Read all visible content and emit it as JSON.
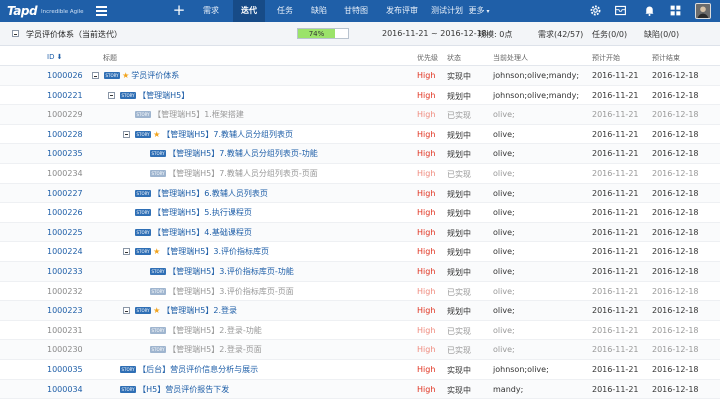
{
  "app": {
    "logo_main": "Tapd",
    "logo_sub": "Incredible Agile"
  },
  "nav": {
    "items": [
      {
        "label": "需求",
        "active": false
      },
      {
        "label": "迭代",
        "active": true
      },
      {
        "label": "任务",
        "active": false
      },
      {
        "label": "缺陷",
        "active": false
      },
      {
        "label": "甘特图",
        "active": false
      },
      {
        "label": "发布评审",
        "active": false
      },
      {
        "label": "测试计划",
        "active": false
      },
      {
        "label": "更多",
        "active": false
      }
    ],
    "icons": [
      "plus-icon",
      "menu-icon",
      "gear-icon",
      "inbox-icon",
      "bell-icon",
      "apps-grid-icon"
    ]
  },
  "summary": {
    "title": "学员评价体系（当前迭代）",
    "progress_label": "74%",
    "progress": 0.74,
    "dates": "2016-11-21 ~ 2016-12-18",
    "scale": "规模: 0点",
    "requirements": "需求(42/57)",
    "tasks": "任务(0/0)",
    "bugs": "缺陷(0/0)"
  },
  "columns": {
    "id": "ID ⬇",
    "title": "标题",
    "priority": "优先级",
    "status": "状态",
    "owner": "当前处理人",
    "start": "预计开始",
    "end": "预计结束"
  },
  "rows": [
    {
      "id": "1000026",
      "level": 0,
      "collapse": true,
      "star": true,
      "title": "学员评价体系",
      "priority": "High",
      "status": "实现中",
      "owner": "johnson;olive;mandy;",
      "start": "2016-11-21",
      "end": "2016-12-18",
      "done": false
    },
    {
      "id": "1000221",
      "level": 1,
      "collapse": true,
      "star": false,
      "title": "【管理端H5】",
      "priority": "High",
      "status": "规划中",
      "owner": "johnson;olive;mandy;",
      "start": "2016-11-21",
      "end": "2016-12-18",
      "done": false
    },
    {
      "id": "1000229",
      "level": 2,
      "collapse": false,
      "star": false,
      "title": "【管理端H5】1.框架搭建",
      "priority": "High",
      "status": "已实现",
      "owner": "olive;",
      "start": "2016-11-21",
      "end": "2016-12-18",
      "done": true
    },
    {
      "id": "1000228",
      "level": 2,
      "collapse": true,
      "star": true,
      "title": "【管理端H5】7.教辅人员分组列表页",
      "priority": "High",
      "status": "规划中",
      "owner": "olive;",
      "start": "2016-11-21",
      "end": "2016-12-18",
      "done": false
    },
    {
      "id": "1000235",
      "level": 3,
      "collapse": false,
      "star": false,
      "title": "【管理端H5】7.教辅人员分组列表页-功能",
      "priority": "High",
      "status": "规划中",
      "owner": "olive;",
      "start": "2016-11-21",
      "end": "2016-12-18",
      "done": false
    },
    {
      "id": "1000234",
      "level": 3,
      "collapse": false,
      "star": false,
      "title": "【管理端H5】7.教辅人员分组列表页-页面",
      "priority": "High",
      "status": "已实现",
      "owner": "olive;",
      "start": "2016-11-21",
      "end": "2016-12-18",
      "done": true
    },
    {
      "id": "1000227",
      "level": 2,
      "collapse": false,
      "star": false,
      "title": "【管理端H5】6.教辅人员列表页",
      "priority": "High",
      "status": "规划中",
      "owner": "olive;",
      "start": "2016-11-21",
      "end": "2016-12-18",
      "done": false
    },
    {
      "id": "1000226",
      "level": 2,
      "collapse": false,
      "star": false,
      "title": "【管理端H5】5.执行课程页",
      "priority": "High",
      "status": "规划中",
      "owner": "olive;",
      "start": "2016-11-21",
      "end": "2016-12-18",
      "done": false
    },
    {
      "id": "1000225",
      "level": 2,
      "collapse": false,
      "star": false,
      "title": "【管理端H5】4.基础课程页",
      "priority": "High",
      "status": "规划中",
      "owner": "olive;",
      "start": "2016-11-21",
      "end": "2016-12-18",
      "done": false
    },
    {
      "id": "1000224",
      "level": 2,
      "collapse": true,
      "star": true,
      "title": "【管理端H5】3.评价指标库页",
      "priority": "High",
      "status": "规划中",
      "owner": "olive;",
      "start": "2016-11-21",
      "end": "2016-12-18",
      "done": false
    },
    {
      "id": "1000233",
      "level": 3,
      "collapse": false,
      "star": false,
      "title": "【管理端H5】3.评价指标库页-功能",
      "priority": "High",
      "status": "规划中",
      "owner": "olive;",
      "start": "2016-11-21",
      "end": "2016-12-18",
      "done": false
    },
    {
      "id": "1000232",
      "level": 3,
      "collapse": false,
      "star": false,
      "title": "【管理端H5】3.评价指标库页-页面",
      "priority": "High",
      "status": "已实现",
      "owner": "olive;",
      "start": "2016-11-21",
      "end": "2016-12-18",
      "done": true
    },
    {
      "id": "1000223",
      "level": 2,
      "collapse": true,
      "star": true,
      "title": "【管理端H5】2.登录",
      "priority": "High",
      "status": "规划中",
      "owner": "olive;",
      "start": "2016-11-21",
      "end": "2016-12-18",
      "done": false
    },
    {
      "id": "1000231",
      "level": 3,
      "collapse": false,
      "star": false,
      "title": "【管理端H5】2.登录-功能",
      "priority": "High",
      "status": "已实现",
      "owner": "olive;",
      "start": "2016-11-21",
      "end": "2016-12-18",
      "done": true
    },
    {
      "id": "1000230",
      "level": 3,
      "collapse": false,
      "star": false,
      "title": "【管理端H5】2.登录-页面",
      "priority": "High",
      "status": "已实现",
      "owner": "olive;",
      "start": "2016-11-21",
      "end": "2016-12-18",
      "done": true
    },
    {
      "id": "1000035",
      "level": 1,
      "collapse": false,
      "star": false,
      "title": "【后台】营员评价信息分析与展示",
      "priority": "High",
      "status": "实现中",
      "owner": "johnson;olive;",
      "start": "2016-11-21",
      "end": "2016-12-18",
      "done": false
    },
    {
      "id": "1000034",
      "level": 1,
      "collapse": false,
      "star": false,
      "title": "【H5】营员评价报告下发",
      "priority": "High",
      "status": "实现中",
      "owner": "mandy;",
      "start": "2016-11-21",
      "end": "2016-12-18",
      "done": false
    }
  ],
  "story_tag": "STORY",
  "colors": {
    "topbar": "#1f5fa8",
    "active_tab": "#174b87",
    "progress": "#9be36a",
    "priority_high": "#e0311e",
    "link": "#1f5fa8"
  }
}
